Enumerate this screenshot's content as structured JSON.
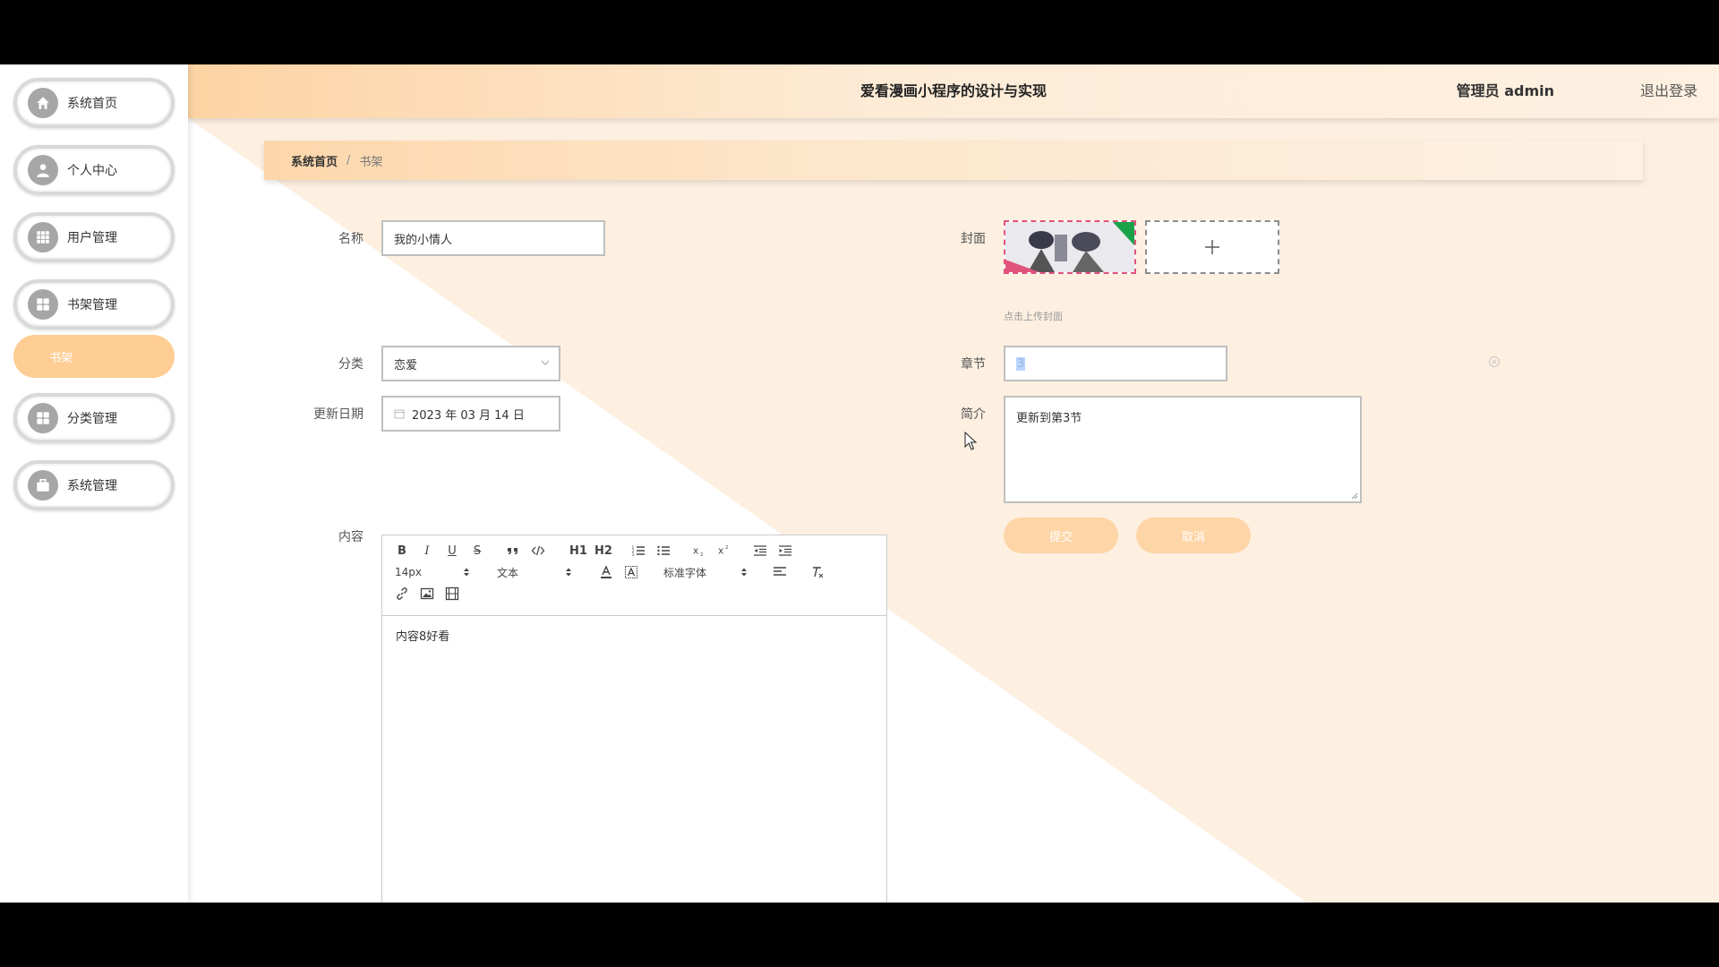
{
  "header": {
    "title": "爱看漫画小程序的设计与实现",
    "user": "管理员 admin",
    "logout": "退出登录"
  },
  "sidebar": {
    "items": [
      {
        "label": "系统首页",
        "icon": "home-icon"
      },
      {
        "label": "个人中心",
        "icon": "user-icon"
      },
      {
        "label": "用户管理",
        "icon": "grid-icon"
      },
      {
        "label": "书架管理",
        "icon": "apps-icon"
      },
      {
        "label": "分类管理",
        "icon": "apps-icon"
      },
      {
        "label": "系统管理",
        "icon": "briefcase-icon"
      }
    ],
    "sub_active": "书架"
  },
  "breadcrumb": {
    "home": "系统首页",
    "separator": "/",
    "current": "书架"
  },
  "form": {
    "name_label": "名称",
    "name_value": "我的小情人",
    "category_label": "分类",
    "category_value": "恋爱",
    "date_label": "更新日期",
    "date_value": "2023 年 03 月 14 日",
    "cover_label": "封面",
    "cover_tip": "点击上传封面",
    "chapter_label": "章节",
    "chapter_value": "3",
    "intro_label": "简介",
    "intro_value": "更新到第3节",
    "content_label": "内容",
    "submit": "提交",
    "cancel": "取消"
  },
  "editor": {
    "font_size": "14px",
    "heading": "文本",
    "font_family": "标准字体",
    "h1": "H1",
    "h2": "H2",
    "content": "内容8好看"
  },
  "colors": {
    "accent": "#fecd94",
    "button": "#fed5a6",
    "bg_diagonal": "#fdefdf"
  }
}
